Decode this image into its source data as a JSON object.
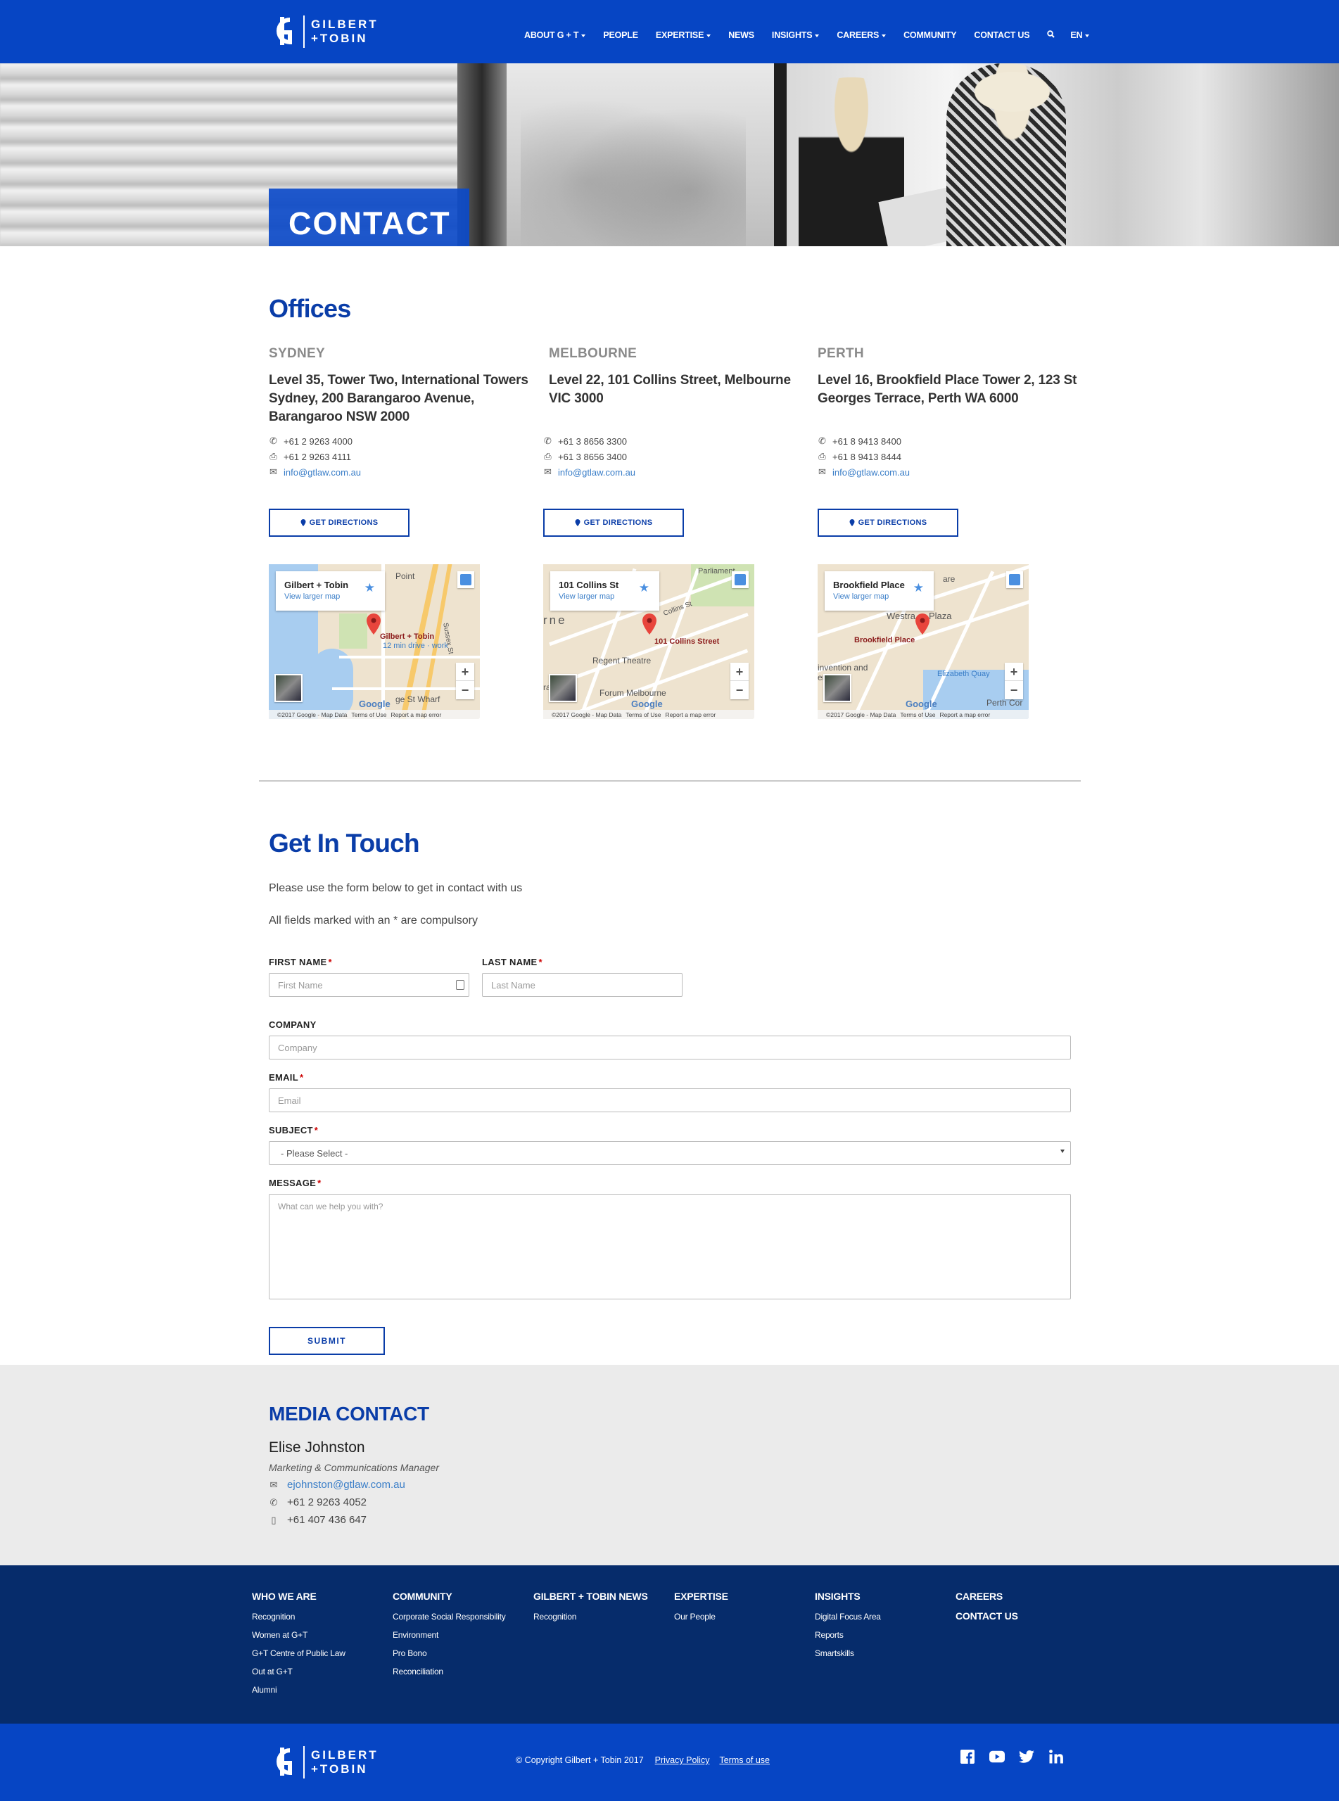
{
  "header": {
    "logo_line1": "GILBERT",
    "logo_line2": "+TOBIN",
    "nav": [
      {
        "label": "ABOUT G + T",
        "dropdown": true
      },
      {
        "label": "PEOPLE",
        "dropdown": false
      },
      {
        "label": "EXPERTISE",
        "dropdown": true
      },
      {
        "label": "NEWS",
        "dropdown": false
      },
      {
        "label": "INSIGHTS",
        "dropdown": true
      },
      {
        "label": "CAREERS",
        "dropdown": true
      },
      {
        "label": "COMMUNITY",
        "dropdown": false
      },
      {
        "label": "CONTACT US",
        "dropdown": false
      }
    ],
    "lang": "EN",
    "search_icon": "search-icon"
  },
  "hero": {
    "title": "CONTACT"
  },
  "offices": {
    "title": "Offices",
    "items": [
      {
        "city": "SYDNEY",
        "address": "Level 35, Tower Two, International Towers Sydney, 200 Barangaroo Avenue, Barangaroo NSW 2000",
        "phone": "+61 2 9263 4000",
        "fax": "+61 2 9263 4111",
        "email": "info@gtlaw.com.au",
        "directions": "GET DIRECTIONS",
        "map": {
          "place": "Gilbert + Tobin",
          "larger": "View larger map",
          "marker_label": "Gilbert + Tobin",
          "marker_sub": "12 min drive · work",
          "footer": [
            "©2017 Google - Map Data",
            "Terms of Use",
            "Report a map error"
          ]
        }
      },
      {
        "city": "MELBOURNE",
        "address": "Level 22, 101 Collins Street, Melbourne VIC 3000",
        "phone": "+61 3 8656 3300",
        "fax": "+61 3 8656 3400",
        "email": "info@gtlaw.com.au",
        "directions": "GET DIRECTIONS",
        "map": {
          "place": "101 Collins St",
          "larger": "View larger map",
          "marker_label": "101 Collins Street",
          "marker_sub": "",
          "footer": [
            "©2017 Google - Map Data",
            "Terms of Use",
            "Report a map error"
          ]
        }
      },
      {
        "city": "PERTH",
        "address": "Level 16, Brookfield Place Tower 2, 123 St Georges Terrace, Perth WA 6000",
        "phone": "+61 8 9413 8400",
        "fax": "+61 8 9413 8444",
        "email": "info@gtlaw.com.au",
        "directions": "GET DIRECTIONS",
        "map": {
          "place": "Brookfield Place",
          "larger": "View larger map",
          "marker_label": "Brookfield Place",
          "marker_sub": "",
          "footer": [
            "©2017 Google - Map Data",
            "Terms of Use",
            "Report a map error"
          ]
        }
      }
    ]
  },
  "map_extra": {
    "sydney_street": "Sussex St",
    "sydney_wharf": "ge St Wharf",
    "sydney_point": "Point",
    "melb_parliament": "Parliament",
    "melb_collins": "Collins St",
    "melb_regent": "Regent Theatre",
    "melb_forum": "Forum Melbourne",
    "melb_rne": "rne",
    "melb_ral": "ral",
    "perth_westrail": "Westra",
    "perth_plaza": "Plaza",
    "perth_quay": "Elizabeth Quay",
    "perth_invention": "invention and",
    "perth_centre": "entre",
    "perth_square": "are",
    "perth_city": "Perth Cor",
    "google": "Google"
  },
  "form": {
    "title": "Get In Touch",
    "intro": "Please use the form below to get in contact with us",
    "note": "All fields marked with an * are compulsory",
    "first_name_label": "FIRST NAME",
    "first_name_ph": "First Name",
    "last_name_label": "LAST NAME",
    "last_name_ph": "Last Name",
    "company_label": "COMPANY",
    "company_ph": "Company",
    "email_label": "EMAIL",
    "email_ph": "Email",
    "subject_label": "SUBJECT",
    "subject_value": "- Please Select -",
    "message_label": "MESSAGE",
    "message_ph": "What can we help you with?",
    "required_mark": "*",
    "submit": "SUBMIT"
  },
  "media": {
    "title": "MEDIA CONTACT",
    "name": "Elise Johnston",
    "role": "Marketing & Communications Manager",
    "email": "ejohnston@gtlaw.com.au",
    "phone": "+61 2 9263 4052",
    "mobile": "+61 407 436 647"
  },
  "footer": {
    "columns": [
      {
        "head": "WHO WE ARE",
        "items": [
          "Recognition",
          "Women at G+T",
          "G+T Centre of Public Law",
          "Out at G+T",
          "Alumni"
        ]
      },
      {
        "head": "COMMUNITY",
        "items": [
          "Corporate Social Responsibility",
          "Environment",
          "Pro Bono",
          "Reconciliation"
        ]
      },
      {
        "head": "GILBERT + TOBIN NEWS",
        "items": [
          "Recognition"
        ]
      },
      {
        "head": "EXPERTISE",
        "items": [
          "Our People"
        ]
      },
      {
        "head": "INSIGHTS",
        "items": [
          "Digital Focus Area",
          "Reports",
          "Smartskills"
        ]
      },
      {
        "head": "CAREERS",
        "items": []
      }
    ],
    "contact_us": "CONTACT US",
    "copyright": "© Copyright Gilbert + Tobin 2017",
    "privacy": "Privacy Policy",
    "terms": "Terms of use",
    "social": [
      "facebook-icon",
      "youtube-icon",
      "twitter-icon",
      "linkedin-icon"
    ]
  },
  "colors": {
    "brand_blue": "#0645c4",
    "heading_blue": "#0a3da8",
    "footer_navy": "#062c6b",
    "media_bg": "#ebebeb"
  }
}
